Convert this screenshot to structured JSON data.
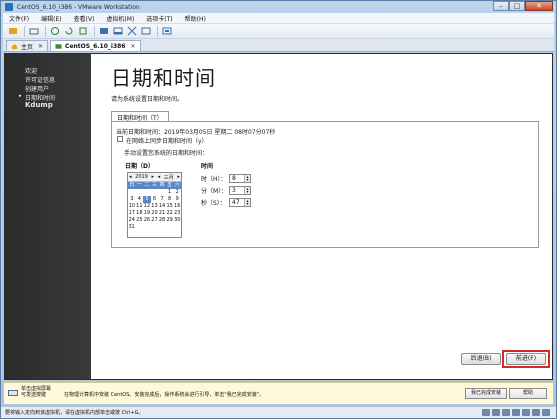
{
  "window": {
    "title": "CentOS_6.10_i386 - VMware Workstation",
    "minimize": "–",
    "maximize": "□",
    "close": "✕"
  },
  "menu": [
    "文件(F)",
    "编辑(E)",
    "查看(V)",
    "虚拟机(M)",
    "选项卡(T)",
    "帮助(H)"
  ],
  "tabs": [
    {
      "label": "主页",
      "close": "✕"
    },
    {
      "label": "CentOS_6.10_i386",
      "close": "✕"
    }
  ],
  "guest": {
    "sidebar": [
      "欢迎",
      "许可证信息",
      "创建用户",
      "日期和时间",
      "Kdump"
    ],
    "current_arrow": "▸",
    "title": "日期和时间",
    "instruction": "请为系统设置日期和时间。",
    "tab": "日期和时间（T）",
    "current_datetime": "当前日期和时间：2019年03月05日 星期二 08时07分07秒",
    "ntp_checkbox": "在网络上同步日期和时间（y）",
    "manual_label": "手动设置您系统的日期和时间：",
    "date_label": "日期（D）",
    "time_label": "时间",
    "calendar": {
      "prev_year": "◂",
      "year": "2019",
      "next_year": "▸",
      "prev_month": "◂",
      "month": "三月",
      "next_month": "▸",
      "weekdays": [
        "日",
        "一",
        "二",
        "三",
        "四",
        "五",
        "六"
      ],
      "days": [
        "",
        "",
        "",
        "",
        "",
        "1",
        "2",
        "3",
        "4",
        "5",
        "6",
        "7",
        "8",
        "9",
        "10",
        "11",
        "12",
        "13",
        "14",
        "15",
        "16",
        "17",
        "18",
        "19",
        "20",
        "21",
        "22",
        "23",
        "24",
        "25",
        "26",
        "27",
        "28",
        "29",
        "30",
        "31"
      ],
      "selected": "5"
    },
    "time": {
      "hour_label": "时（H）：",
      "hour": "8",
      "minute_label": "分（M）：",
      "minute": "3",
      "second_label": "秒（S）：",
      "second": "47"
    },
    "back_button": "后退(B)",
    "forward_button": "前进(F)"
  },
  "hint": {
    "line1": "单击虚拟屏幕",
    "line2": "可发送按键",
    "message": "在物理计算机中安装 CentOS。安装完成后，操作系统会进行引导，单击\"我已完成安装\"。",
    "done_button": "我已完成安装",
    "help_button": "帮助"
  },
  "status": "要将输入定向到该虚拟机，请在虚拟机内部单击或按 Ctrl+G。",
  "colors": {
    "highlight": "#d62a2a",
    "calendar_accent": "#5b87c4"
  }
}
